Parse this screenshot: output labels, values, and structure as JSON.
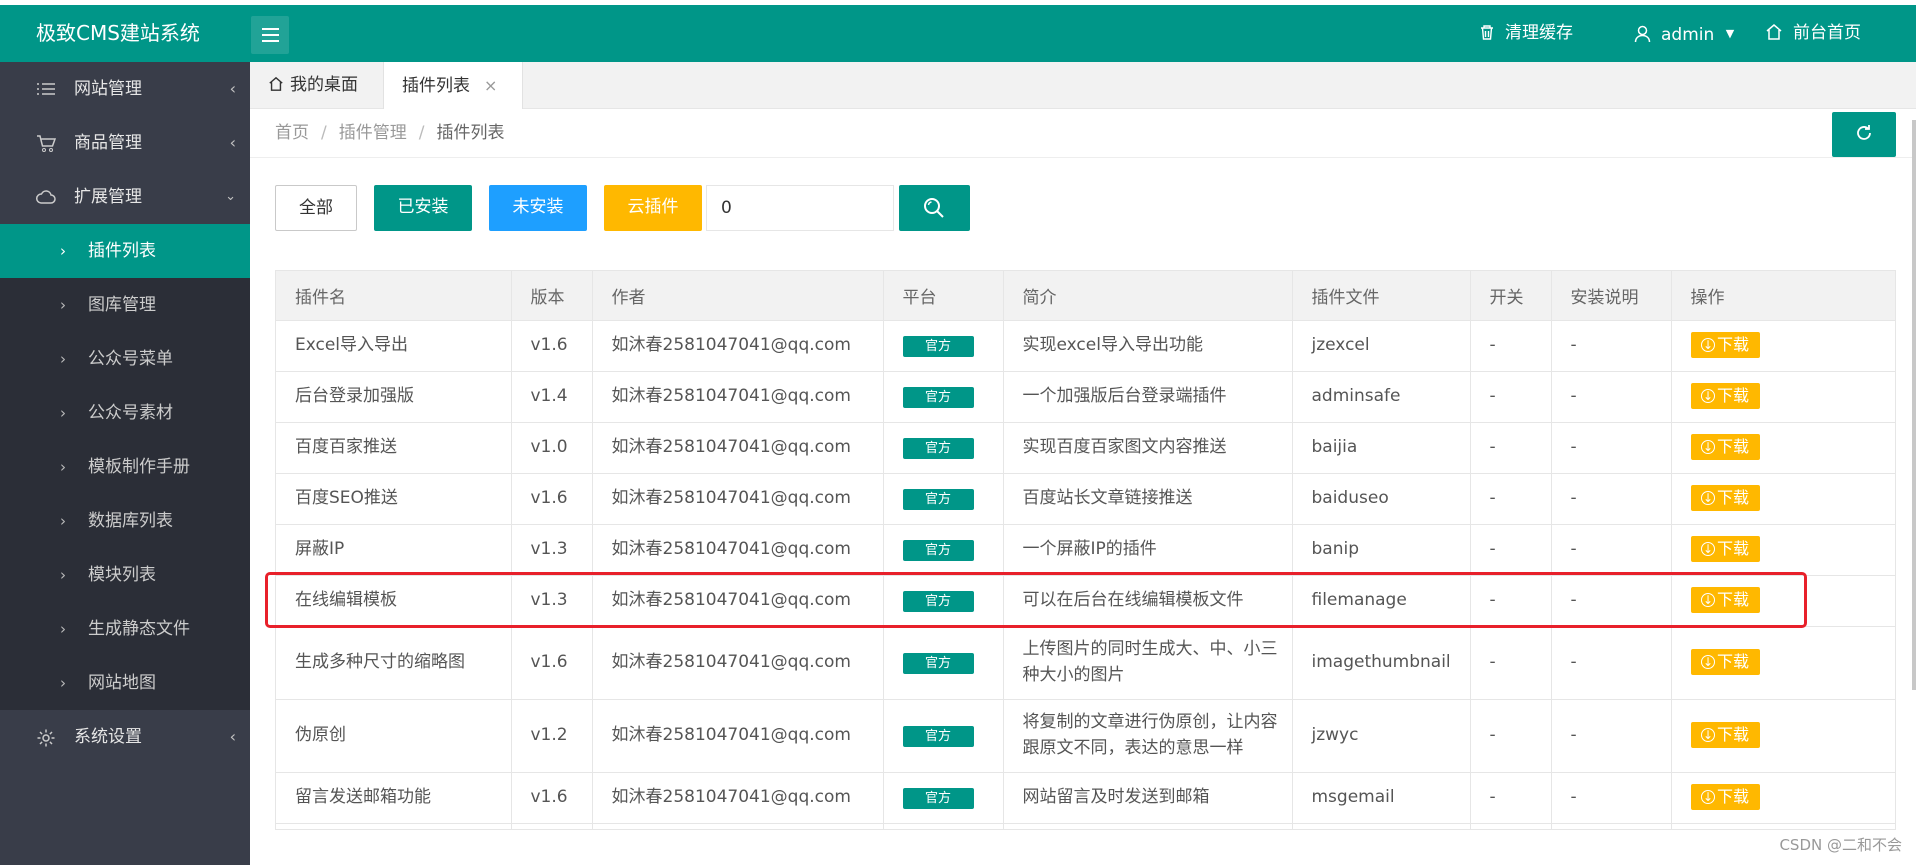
{
  "header": {
    "brand": "极致CMS建站系统",
    "clear_cache": "清理缓存",
    "user": "admin",
    "frontend_home": "前台首页"
  },
  "sidebar": {
    "groups": [
      {
        "label": "网站管理",
        "icon": "list-icon"
      },
      {
        "label": "商品管理",
        "icon": "cart-icon"
      },
      {
        "label": "扩展管理",
        "icon": "cloud-icon"
      }
    ],
    "items": [
      {
        "label": "插件列表",
        "active": true
      },
      {
        "label": "图库管理"
      },
      {
        "label": "公众号菜单"
      },
      {
        "label": "公众号素材"
      },
      {
        "label": "模板制作手册"
      },
      {
        "label": "数据库列表"
      },
      {
        "label": "模块列表"
      },
      {
        "label": "生成静态文件"
      },
      {
        "label": "网站地图"
      }
    ],
    "settings": {
      "label": "系统设置",
      "icon": "gear-icon"
    }
  },
  "tabs": {
    "home": "我的桌面",
    "current": "插件列表",
    "close_glyph": "×"
  },
  "breadcrumb": {
    "items": [
      "首页",
      "插件管理",
      "插件列表"
    ],
    "separator": "/"
  },
  "filters": {
    "all": "全部",
    "installed": "已安装",
    "uninstalled": "未安装",
    "cloud": "云插件",
    "search_value": "0"
  },
  "table": {
    "headers": [
      "插件名",
      "版本",
      "作者",
      "平台",
      "简介",
      "插件文件",
      "开关",
      "安装说明",
      "操作"
    ],
    "rows": [
      {
        "name": "Excel导入导出",
        "version": "v1.6",
        "author": "如沐春2581047041@qq.com",
        "platform": "官方",
        "desc": "实现excel导入导出功能",
        "file": "jzexcel",
        "switch": "-",
        "install": "-",
        "action": "下载"
      },
      {
        "name": "后台登录加强版",
        "version": "v1.4",
        "author": "如沐春2581047041@qq.com",
        "platform": "官方",
        "desc": "一个加强版后台登录端插件",
        "file": "adminsafe",
        "switch": "-",
        "install": "-",
        "action": "下载"
      },
      {
        "name": "百度百家推送",
        "version": "v1.0",
        "author": "如沐春2581047041@qq.com",
        "platform": "官方",
        "desc": "实现百度百家图文内容推送",
        "file": "baijia",
        "switch": "-",
        "install": "-",
        "action": "下载"
      },
      {
        "name": "百度SEO推送",
        "version": "v1.6",
        "author": "如沐春2581047041@qq.com",
        "platform": "官方",
        "desc": "百度站长文章链接推送",
        "file": "baiduseo",
        "switch": "-",
        "install": "-",
        "action": "下载"
      },
      {
        "name": "屏蔽IP",
        "version": "v1.3",
        "author": "如沐春2581047041@qq.com",
        "platform": "官方",
        "desc": "一个屏蔽IP的插件",
        "file": "banip",
        "switch": "-",
        "install": "-",
        "action": "下载"
      },
      {
        "name": "在线编辑模板",
        "version": "v1.3",
        "author": "如沐春2581047041@qq.com",
        "platform": "官方",
        "desc": "可以在后台在线编辑模板文件",
        "file": "filemanage",
        "switch": "-",
        "install": "-",
        "action": "下载"
      },
      {
        "name": "生成多种尺寸的缩略图",
        "version": "v1.6",
        "author": "如沐春2581047041@qq.com",
        "platform": "官方",
        "desc": "上传图片的同时生成大、中、小三种大小的图片",
        "file": "imagethumbnail",
        "switch": "-",
        "install": "-",
        "action": "下载"
      },
      {
        "name": "伪原创",
        "version": "v1.2",
        "author": "如沐春2581047041@qq.com",
        "platform": "官方",
        "desc": "将复制的文章进行伪原创，让内容跟原文不同，表达的意思一样",
        "file": "jzwyc",
        "switch": "-",
        "install": "-",
        "action": "下载"
      },
      {
        "name": "留言发送邮箱功能",
        "version": "v1.6",
        "author": "如沐春2581047041@qq.com",
        "platform": "官方",
        "desc": "网站留言及时发送到邮箱",
        "file": "msgemail",
        "switch": "-",
        "install": "-",
        "action": "下载"
      },
      {
        "name": "",
        "version": "",
        "author": "",
        "platform": "",
        "desc": "",
        "file": "",
        "switch": "",
        "install": "",
        "action": ""
      }
    ]
  },
  "watermark": "CSDN @二和不会",
  "colors": {
    "primary": "#009688",
    "blue": "#1e9fff",
    "warning": "#ffb800",
    "sidebar": "#393d49",
    "highlight": "#e8202a"
  }
}
